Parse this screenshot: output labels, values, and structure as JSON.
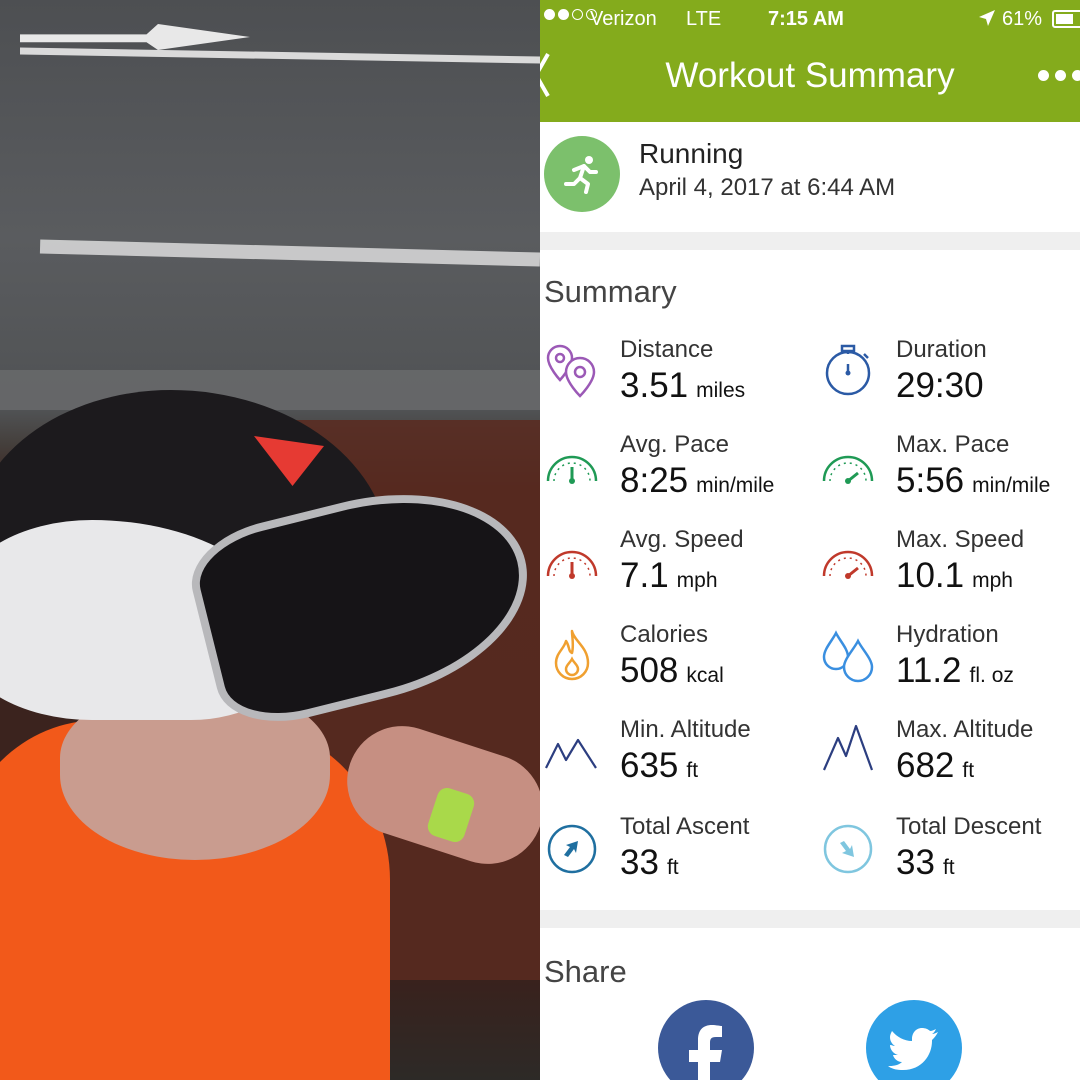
{
  "status_bar": {
    "carrier": "Verizon",
    "network": "LTE",
    "time": "7:15 AM",
    "battery": "61%",
    "battery_level": 0.61,
    "signal_bars": 2
  },
  "nav": {
    "title": "Workout Summary"
  },
  "activity": {
    "name": "Running",
    "date": "April 4, 2017 at 6:44 AM"
  },
  "summary": {
    "title": "Summary",
    "stats": [
      {
        "label": "Distance",
        "value": "3.51",
        "unit": "miles",
        "icon": "location-pins-icon"
      },
      {
        "label": "Duration",
        "value": "29:30",
        "unit": "",
        "icon": "stopwatch-icon"
      },
      {
        "label": "Avg. Pace",
        "value": "8:25",
        "unit": "min/mile",
        "icon": "avg-pace-gauge-icon"
      },
      {
        "label": "Max. Pace",
        "value": "5:56",
        "unit": "min/mile",
        "icon": "max-pace-gauge-icon"
      },
      {
        "label": "Avg. Speed",
        "value": "7.1",
        "unit": "mph",
        "icon": "avg-speed-gauge-icon"
      },
      {
        "label": "Max. Speed",
        "value": "10.1",
        "unit": "mph",
        "icon": "max-speed-gauge-icon"
      },
      {
        "label": "Calories",
        "value": "508",
        "unit": "kcal",
        "icon": "flame-icon"
      },
      {
        "label": "Hydration",
        "value": "11.2",
        "unit": "fl. oz",
        "icon": "water-drops-icon"
      },
      {
        "label": "Min. Altitude",
        "value": "635",
        "unit": "ft",
        "icon": "min-altitude-mountain-icon"
      },
      {
        "label": "Max. Altitude",
        "value": "682",
        "unit": "ft",
        "icon": "max-altitude-mountain-icon"
      },
      {
        "label": "Total Ascent",
        "value": "33",
        "unit": "ft",
        "icon": "ascent-arrow-icon"
      },
      {
        "label": "Total Descent",
        "value": "33",
        "unit": "ft",
        "icon": "descent-arrow-icon"
      }
    ]
  },
  "share": {
    "title": "Share",
    "buttons": [
      {
        "name": "Facebook",
        "icon": "facebook-icon"
      },
      {
        "name": "Twitter",
        "icon": "twitter-icon"
      }
    ]
  },
  "colors": {
    "header_green": "#84ab1c",
    "activity_badge": "#7cc06c",
    "distance_purple": "#9b59b6",
    "duration_blue": "#2b5aa5",
    "pace_green": "#1f9a55",
    "speed_red": "#c0392b",
    "calories_orange": "#f0a030",
    "hydration_blue": "#3a8fe0",
    "altitude_navy": "#2c3e80",
    "ascent_teal": "#1f6fa0",
    "descent_lightblue": "#7fc6df",
    "facebook": "#3b5998",
    "twitter": "#2ea0e6"
  }
}
